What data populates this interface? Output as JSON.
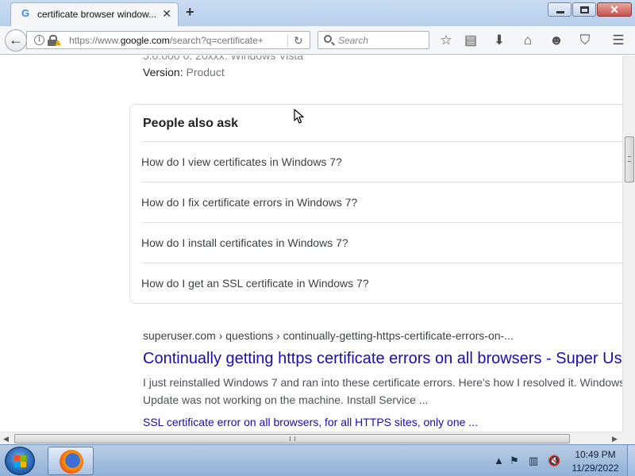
{
  "browser": {
    "tab_title": "certificate browser window...",
    "tab_favicon": "G",
    "tab_close": "✕",
    "new_tab": "+",
    "url_prefix": "https://www.",
    "url_host": "google.com",
    "url_rest": "/search?q=certificate+",
    "search_placeholder": "Search",
    "icons": [
      "back-arrow-icon",
      "info-icon",
      "lock-icon",
      "reload-icon",
      "search-icon",
      "bookmark-star-icon",
      "reader-list-icon",
      "download-icon",
      "home-icon",
      "smiley-icon",
      "pocket-icon",
      "hamburger-menu-icon"
    ]
  },
  "page": {
    "prev_line": "5.0.000 0. 20xxx: Windows Vista",
    "version_label": "Version: ",
    "version_value": "Product",
    "paa_title": "People also ask",
    "paa_questions": [
      "How do I view certificates in Windows 7?",
      "How do I fix certificate errors in Windows 7?",
      "How do I install certificates in Windows 7?",
      "How do I get an SSL certificate in Windows 7?"
    ],
    "result": {
      "cite": "superuser.com › questions › continually-getting-https-certificate-errors-on-...",
      "title": "Continually getting https certificate errors on all browsers - Super User",
      "snippet_line1": "I just reinstalled Windows 7 and ran into these certificate errors. Here's how I resolved it. Windows",
      "snippet_line2": "Update was not working on the machine. Install Service ...",
      "sub_link": "SSL certificate error on all browsers, for all HTTPS sites, only one ..."
    }
  },
  "taskbar": {
    "time": "10:49 PM",
    "date": "11/29/2022",
    "tray_icons": [
      "show-hidden-icons",
      "action-center-flag-icon",
      "network-icon",
      "volume-muted-icon"
    ]
  },
  "colors": {
    "link_blue": "#1a0dab",
    "snippet_gray": "#4d5156",
    "taskbar_blue": "#9fbbe0"
  }
}
